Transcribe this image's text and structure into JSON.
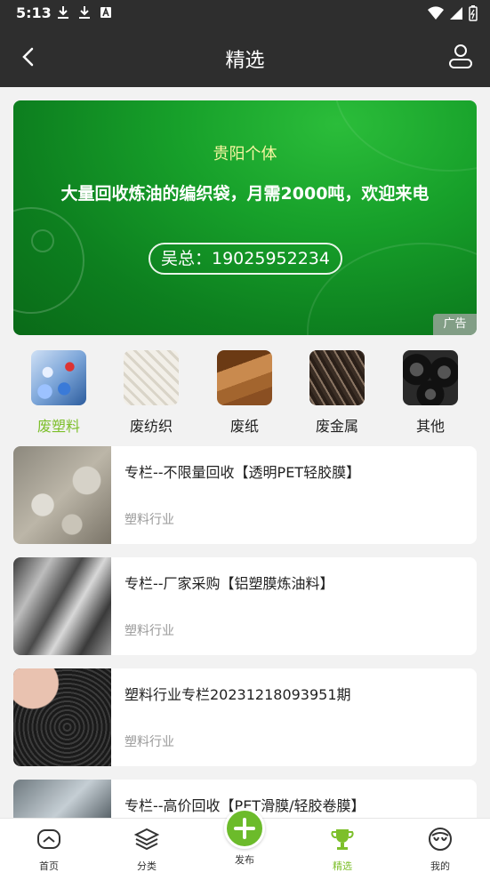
{
  "status": {
    "time": "5:13"
  },
  "header": {
    "title": "精选"
  },
  "banner": {
    "line1": "贵阳个体",
    "line2": "大量回收炼油的编织袋，月需2000吨，欢迎来电",
    "contact": "吴总：19025952234",
    "ad_label": "广告"
  },
  "categories": [
    {
      "label": "废塑料",
      "active": true
    },
    {
      "label": "废纺织"
    },
    {
      "label": "废纸"
    },
    {
      "label": "废金属"
    },
    {
      "label": "其他"
    }
  ],
  "articles": [
    {
      "title": "专栏--不限量回收【透明PET轻胶膜】",
      "tag": "塑料行业"
    },
    {
      "title": "专栏--厂家采购【铝塑膜炼油料】",
      "tag": "塑料行业"
    },
    {
      "title": "塑料行业专栏20231218093951期",
      "tag": "塑料行业"
    },
    {
      "title": "专栏--高价回收【PET滑膜/轻胶卷膜】",
      "tag": ""
    }
  ],
  "tabbar": {
    "home": "首页",
    "category": "分类",
    "publish": "发布",
    "featured": "精选",
    "mine": "我的"
  },
  "colors": {
    "accent": "#7dbf2b",
    "bar": "#2e2e2e"
  }
}
